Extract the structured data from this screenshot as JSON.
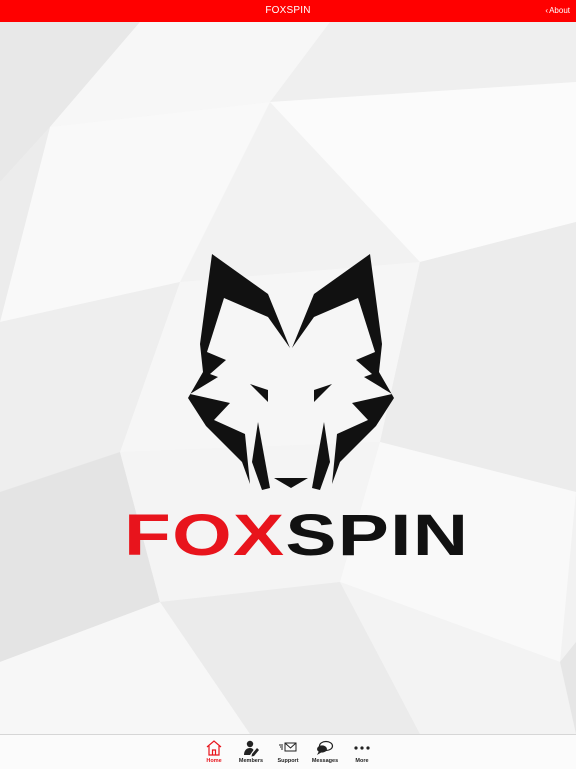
{
  "header": {
    "title": "FOXSPIN",
    "about_label": "About"
  },
  "brand": {
    "part1": "FOX",
    "part2": "SPIN"
  },
  "tabs": [
    {
      "label": "Home",
      "icon": "home-icon",
      "active": true
    },
    {
      "label": "Members",
      "icon": "members-icon",
      "active": false
    },
    {
      "label": "Support",
      "icon": "support-icon",
      "active": false
    },
    {
      "label": "Messages",
      "icon": "messages-icon",
      "active": false
    },
    {
      "label": "More",
      "icon": "more-icon",
      "active": false
    }
  ],
  "colors": {
    "header_bg": "#ff0000",
    "accent": "#e8141c",
    "logo_dark": "#111111"
  }
}
